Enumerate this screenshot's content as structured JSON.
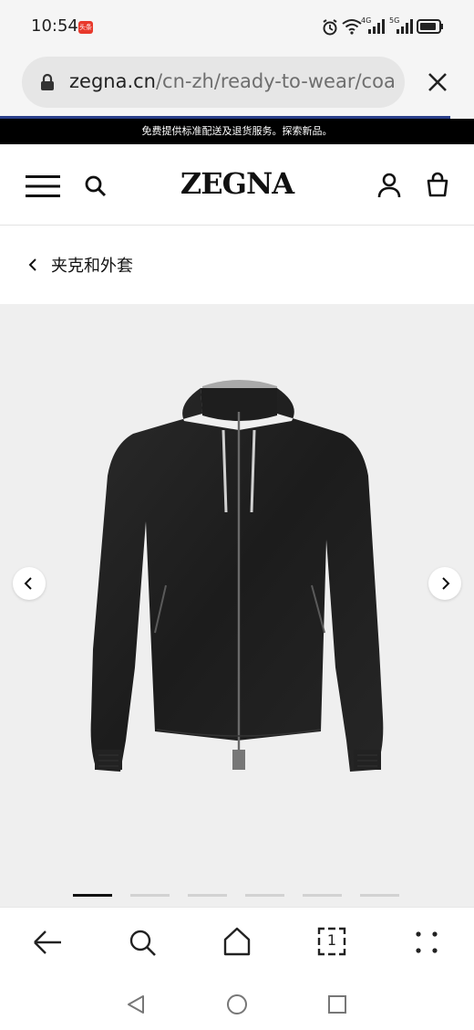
{
  "status_bar": {
    "time": "10:54",
    "app_badge": "头条",
    "net1": "4G",
    "net2": "5G"
  },
  "browser": {
    "url_domain": "zegna.cn",
    "url_path": "/cn-zh/ready-to-wear/coa",
    "progress_color": "#2a3f8a"
  },
  "promo_banner": {
    "text": "免费提供标准配送及退货服务。探索新品。"
  },
  "site_header": {
    "brand": "ZEGNA",
    "icons": [
      "menu-icon",
      "search-icon",
      "account-icon",
      "bag-icon"
    ]
  },
  "breadcrumb": {
    "label": "夹克和外套"
  },
  "gallery": {
    "product_image": "black zip-up jacket with grey reversible collar",
    "image_count": 6,
    "active_index": 0
  },
  "browser_nav": {
    "icons": [
      "back-icon",
      "search-icon",
      "home-icon",
      "tabs-icon",
      "more-icon"
    ],
    "tab_count": "1"
  },
  "system_nav": {
    "icons": [
      "back-triangle-icon",
      "home-circle-icon",
      "recents-square-icon"
    ]
  }
}
